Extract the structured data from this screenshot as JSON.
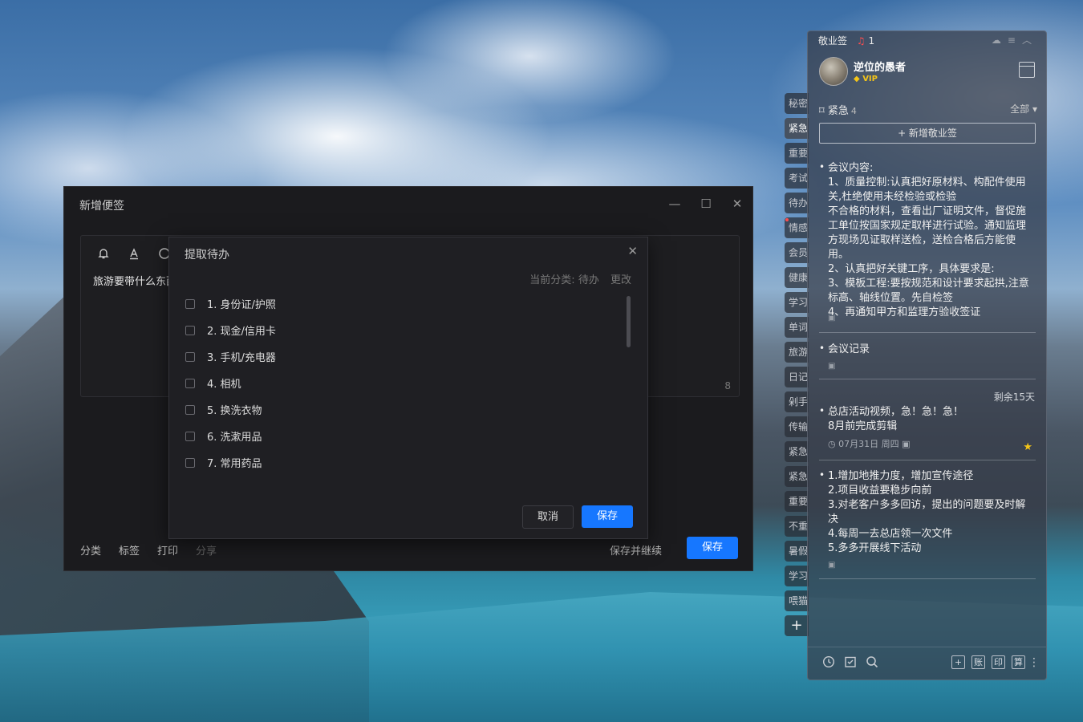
{
  "main_window": {
    "title": "新增便签",
    "controls": {
      "minimize": "—",
      "maximize": "☐",
      "close": "✕"
    },
    "editor": {
      "text": "旅游要带什么东西",
      "char_count": "8",
      "toolbar_icons": [
        "bell-icon",
        "text-color-icon",
        "circle-icon"
      ]
    },
    "bottom_links": [
      "分类",
      "标签",
      "打印",
      "分享"
    ],
    "save_continue": "保存并继续",
    "save": "保存"
  },
  "todo_dialog": {
    "title": "提取待办",
    "close": "✕",
    "category_label": "当前分类:",
    "category_value": "待办",
    "change": "更改",
    "items": [
      "1. 身份证/护照",
      "2. 现金/信用卡",
      "3. 手机/充电器",
      "4. 相机",
      "5. 换洗衣物",
      "6. 洗漱用品",
      "7. 常用药品"
    ],
    "cancel": "取消",
    "save": "保存"
  },
  "side_tabs": [
    "秘密",
    "紧急",
    "重要",
    "考试",
    "待办",
    "情感",
    "会员",
    "健康",
    "学习",
    "单词",
    "旅游",
    "日记",
    "剁手",
    "传输",
    "紧急",
    "紧急",
    "重要",
    "不重",
    "暑假",
    "学习",
    "喂猫"
  ],
  "side_add": "+",
  "note_panel": {
    "app_name": "敬业签",
    "notify_count": "1",
    "user": {
      "name": "逆位的愚者",
      "badge": "VIP"
    },
    "category": {
      "name": "紧急",
      "count": "4",
      "filter": "全部"
    },
    "add_button": "+ 新增敬业签",
    "notes": [
      {
        "lines": [
          "会议内容:",
          "1、质量控制:认真把好原材料、构配件使用关,杜绝使用未经检验或检验",
          "不合格的材料，查看出厂证明文件，督促施工单位按国家规定取样进行试验。通知监理方现场见证取样送检，送检合格后方能使用。",
          "2、认真把好关键工序，具体要求是:",
          "3、模板工程:要按规范和设计要求起拱,注意标高、轴线位置。先自检签",
          "4、再通知甲方和监理方验收签证"
        ]
      },
      {
        "lines": [
          "会议记录"
        ]
      },
      {
        "remain": "剩余15天",
        "lines": [
          "总店活动视频，急！急！急！",
          "8月前完成剪辑"
        ],
        "date": "07月31日 周四"
      },
      {
        "lines": [
          "1.增加地推力度，增加宣传途径",
          "2.项目收益要稳步向前",
          "3.对老客户多多回访，提出的问题要及时解决",
          "4.每周一去总店领一次文件",
          "5.多多开展线下活动"
        ]
      }
    ],
    "footer_boxes": [
      "+",
      "账",
      "印",
      "算"
    ]
  }
}
